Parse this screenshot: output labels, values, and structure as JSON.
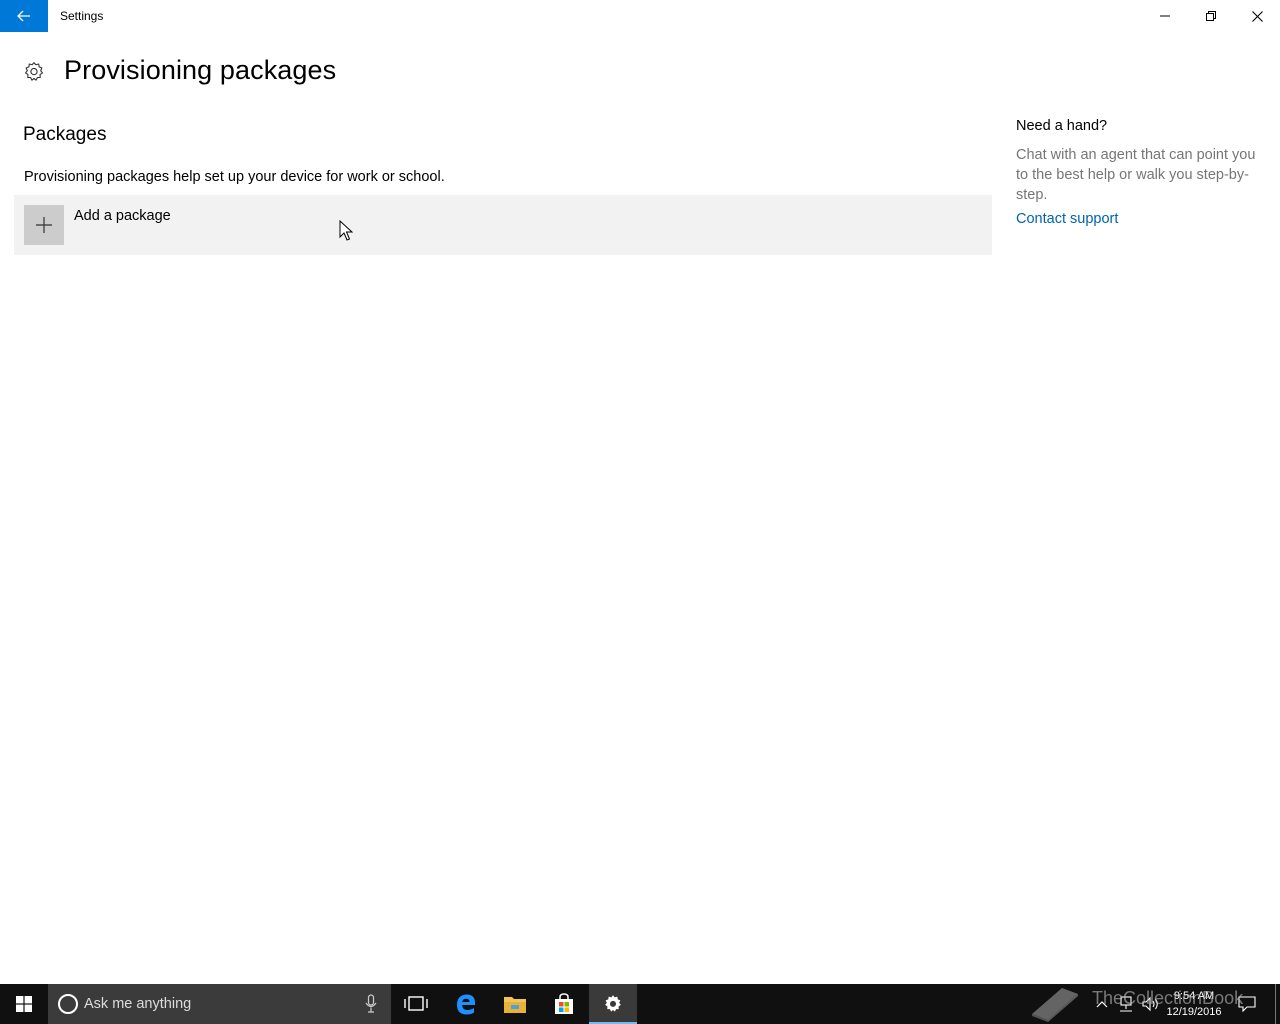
{
  "window": {
    "title": "Settings"
  },
  "header": {
    "title": "Provisioning packages"
  },
  "packages": {
    "section_title": "Packages",
    "description": "Provisioning packages help set up your device for work or school.",
    "add_label": "Add a package"
  },
  "help": {
    "title": "Need a hand?",
    "text": "Chat with an agent that can point you to the best help or walk you step-by-step.",
    "link": "Contact support"
  },
  "taskbar": {
    "search_placeholder": "Ask me anything",
    "time": "9:54 AM",
    "date": "12/19/2016"
  },
  "watermark": "TheCollectionBook",
  "colors": {
    "accent": "#0078d7",
    "link": "#0063b1",
    "taskbar": "#101010"
  }
}
